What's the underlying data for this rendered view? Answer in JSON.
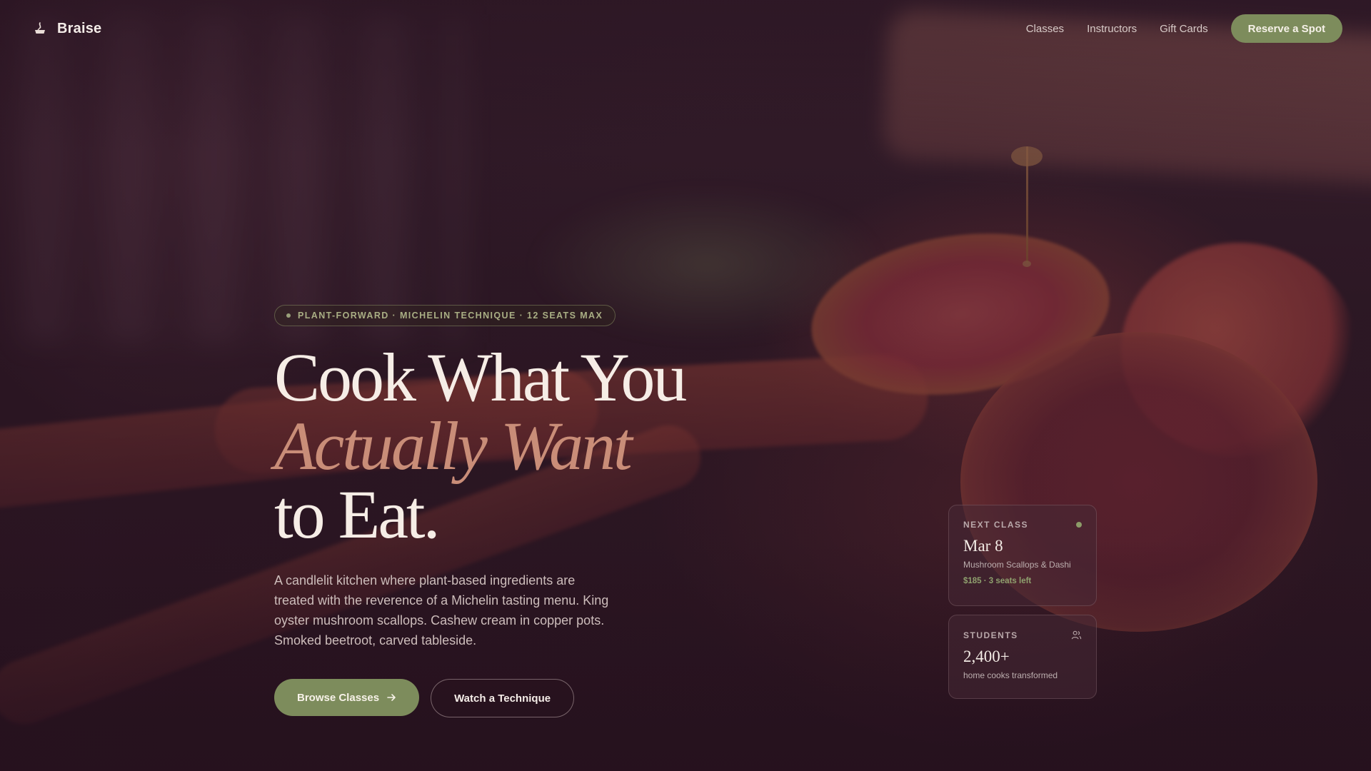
{
  "brand": {
    "name": "Braise",
    "icon": "flame-pot-icon"
  },
  "nav": {
    "links": [
      "Classes",
      "Instructors",
      "Gift Cards"
    ],
    "cta_label": "Reserve a Spot"
  },
  "hero": {
    "tagline": "PLANT-FORWARD · MICHELIN TECHNIQUE · 12 SEATS MAX",
    "headline": {
      "line1": "Cook What You",
      "line2": "Actually Want",
      "line3": "to Eat."
    },
    "description": "A candlelit kitchen where plant-based ingredients are treated with the reverence of a Michelin tasting menu. King oyster mushroom scallops. Cashew cream in copper pots. Smoked beetroot, carved tableside.",
    "primary_button": "Browse Classes",
    "secondary_button": "Watch a Technique"
  },
  "next_class": {
    "label": "NEXT CLASS",
    "date": "Mar 8",
    "title": "Mushroom Scallops & Dashi",
    "meta": "$185 · 3 seats left"
  },
  "students": {
    "label": "STUDENTS",
    "count": "2,400+",
    "caption": "home cooks transformed"
  },
  "colors": {
    "accent_green": "#7d8c5c",
    "accent_rose": "#c98d78",
    "background": "#2a1620"
  }
}
